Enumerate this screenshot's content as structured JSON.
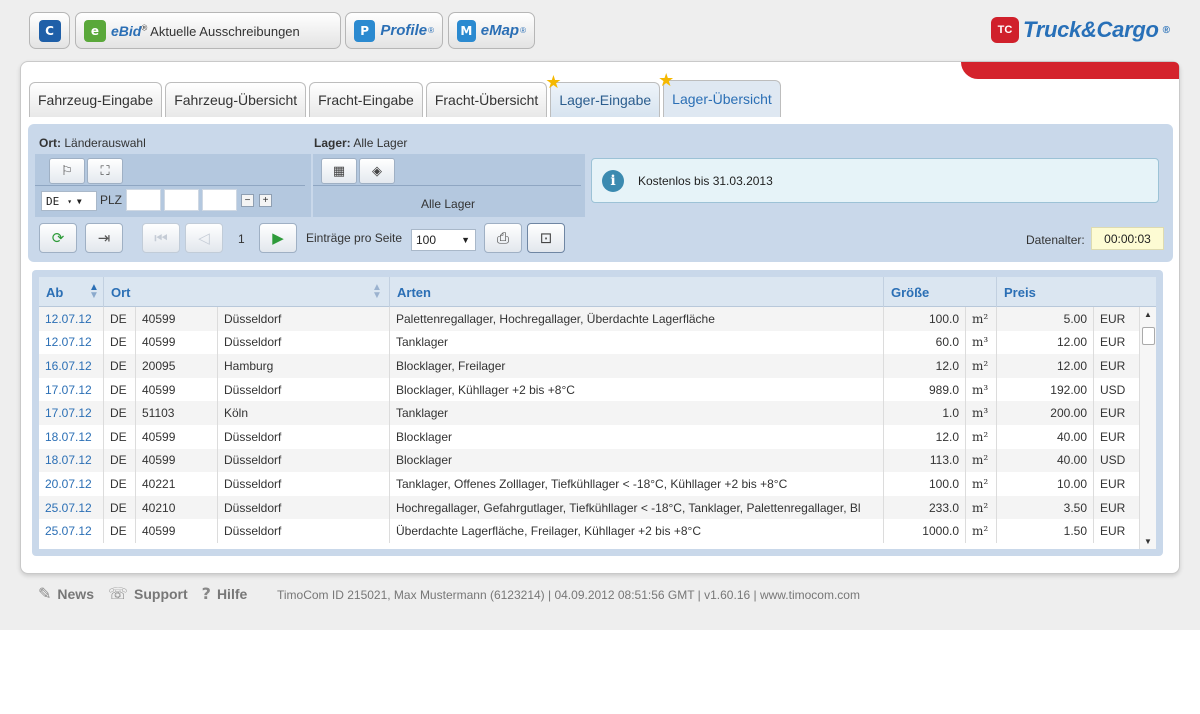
{
  "topbar": {
    "home_label": "",
    "ebid": {
      "brand": "eBid",
      "reg": "®",
      "label": "Aktuelle Ausschreibungen"
    },
    "profile": {
      "brand": "Profile",
      "reg": "®"
    },
    "emap": {
      "brand": "eMap",
      "reg": "®"
    },
    "logo": {
      "mark": "TC",
      "text": "Truck&Cargo",
      "reg": "®"
    }
  },
  "tabs": [
    {
      "label": "Fahrzeug-Eingabe"
    },
    {
      "label": "Fahrzeug-Übersicht"
    },
    {
      "label": "Fracht-Eingabe"
    },
    {
      "label": "Fracht-Übersicht"
    },
    {
      "label": "Lager-Eingabe"
    },
    {
      "label": "Lager-Übersicht"
    }
  ],
  "filter": {
    "ort_label": "Ort:",
    "ort_value": "Länderauswahl",
    "lager_label": "Lager:",
    "lager_value": "Alle Lager",
    "country": "DE",
    "plz_label": "PLZ",
    "minus": "−",
    "plus": "+",
    "lager_caption": "Alle Lager",
    "info_text": "Kostenlos bis 31.03.2013"
  },
  "toolbar": {
    "page_number": "1",
    "entries_label": "Einträge pro Seite",
    "entries_value": "100",
    "datenalter_label": "Datenalter:",
    "datenalter_value": "00:00:03"
  },
  "table": {
    "headers": {
      "ab": "Ab",
      "ort": "Ort",
      "arten": "Arten",
      "groesse": "Größe",
      "preis": "Preis"
    },
    "rows": [
      {
        "date": "12.07.12",
        "country": "DE",
        "plz": "40599",
        "city": "Düsseldorf",
        "arten": "Palettenregallager, Hochregallager, Überdachte Lagerfläche",
        "size": "100.0",
        "unit": "m²",
        "price": "5.00",
        "currency": "EUR"
      },
      {
        "date": "12.07.12",
        "country": "DE",
        "plz": "40599",
        "city": "Düsseldorf",
        "arten": "Tanklager",
        "size": "60.0",
        "unit": "m³",
        "price": "12.00",
        "currency": "EUR"
      },
      {
        "date": "16.07.12",
        "country": "DE",
        "plz": "20095",
        "city": "Hamburg",
        "arten": "Blocklager, Freilager",
        "size": "12.0",
        "unit": "m²",
        "price": "12.00",
        "currency": "EUR"
      },
      {
        "date": "17.07.12",
        "country": "DE",
        "plz": "40599",
        "city": "Düsseldorf",
        "arten": "Blocklager, Kühllager +2 bis +8°C",
        "size": "989.0",
        "unit": "m³",
        "price": "192.00",
        "currency": "USD"
      },
      {
        "date": "17.07.12",
        "country": "DE",
        "plz": "51103",
        "city": "Köln",
        "arten": "Tanklager",
        "size": "1.0",
        "unit": "m³",
        "price": "200.00",
        "currency": "EUR"
      },
      {
        "date": "18.07.12",
        "country": "DE",
        "plz": "40599",
        "city": "Düsseldorf",
        "arten": "Blocklager",
        "size": "12.0",
        "unit": "m²",
        "price": "40.00",
        "currency": "EUR"
      },
      {
        "date": "18.07.12",
        "country": "DE",
        "plz": "40599",
        "city": "Düsseldorf",
        "arten": "Blocklager",
        "size": "113.0",
        "unit": "m²",
        "price": "40.00",
        "currency": "USD"
      },
      {
        "date": "20.07.12",
        "country": "DE",
        "plz": "40221",
        "city": "Düsseldorf",
        "arten": "Tanklager, Offenes Zolllager, Tiefkühllager < -18°C, Kühllager +2 bis +8°C",
        "size": "100.0",
        "unit": "m²",
        "price": "10.00",
        "currency": "EUR"
      },
      {
        "date": "25.07.12",
        "country": "DE",
        "plz": "40210",
        "city": "Düsseldorf",
        "arten": "Hochregallager, Gefahrgutlager, Tiefkühllager < -18°C, Tanklager, Palettenregallager, Bl",
        "size": "233.0",
        "unit": "m²",
        "price": "3.50",
        "currency": "EUR"
      },
      {
        "date": "25.07.12",
        "country": "DE",
        "plz": "40599",
        "city": "Düsseldorf",
        "arten": "Überdachte Lagerfläche, Freilager, Kühllager +2 bis +8°C",
        "size": "1000.0",
        "unit": "m²",
        "price": "1.50",
        "currency": "EUR"
      }
    ]
  },
  "footer": {
    "news": "News",
    "support": "Support",
    "hilfe": "Hilfe",
    "status": "TimoCom ID 215021, Max Mustermann (6123214)  |  04.09.2012 08:51:56 GMT  |  v1.60.16  |  www.timocom.com"
  },
  "colors": {
    "accent": "#2b6fb5",
    "brand_red": "#d4232c",
    "filter_bg": "#c9d8ea",
    "star": "#f5b800"
  },
  "icons": [
    "home-icon",
    "ebid-icon",
    "profile-icon",
    "emap-icon",
    "star-icon",
    "truck-icon",
    "info-icon",
    "refresh-icon",
    "export-icon",
    "first-page-icon",
    "prev-page-icon",
    "next-page-icon",
    "print-icon",
    "lock-icon",
    "news-icon",
    "support-icon",
    "help-icon"
  ]
}
